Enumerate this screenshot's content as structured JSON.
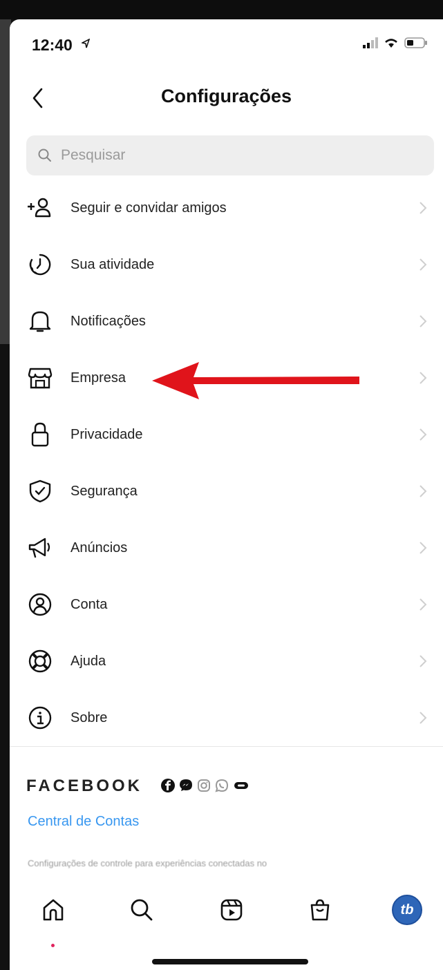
{
  "status": {
    "time": "12:40"
  },
  "header": {
    "title": "Configurações"
  },
  "search": {
    "placeholder": "Pesquisar"
  },
  "menu": {
    "items": [
      {
        "label": "Seguir e convidar amigos",
        "icon": "add-person-icon"
      },
      {
        "label": "Sua atividade",
        "icon": "activity-clock-icon"
      },
      {
        "label": "Notificações",
        "icon": "bell-icon"
      },
      {
        "label": "Empresa",
        "icon": "storefront-icon"
      },
      {
        "label": "Privacidade",
        "icon": "lock-icon"
      },
      {
        "label": "Segurança",
        "icon": "shield-check-icon"
      },
      {
        "label": "Anúncios",
        "icon": "megaphone-icon"
      },
      {
        "label": "Conta",
        "icon": "account-circle-icon"
      },
      {
        "label": "Ajuda",
        "icon": "lifebuoy-icon"
      },
      {
        "label": "Sobre",
        "icon": "info-icon"
      }
    ]
  },
  "facebook": {
    "title": "FACEBOOK",
    "link": "Central de Contas",
    "description": "Configurações de controle para experiências conectadas no"
  },
  "tabbar": {
    "avatar_initials": "tb"
  },
  "colors": {
    "link": "#3897f0",
    "arrow": "#e0141b",
    "avatar": "#2e66b8"
  }
}
